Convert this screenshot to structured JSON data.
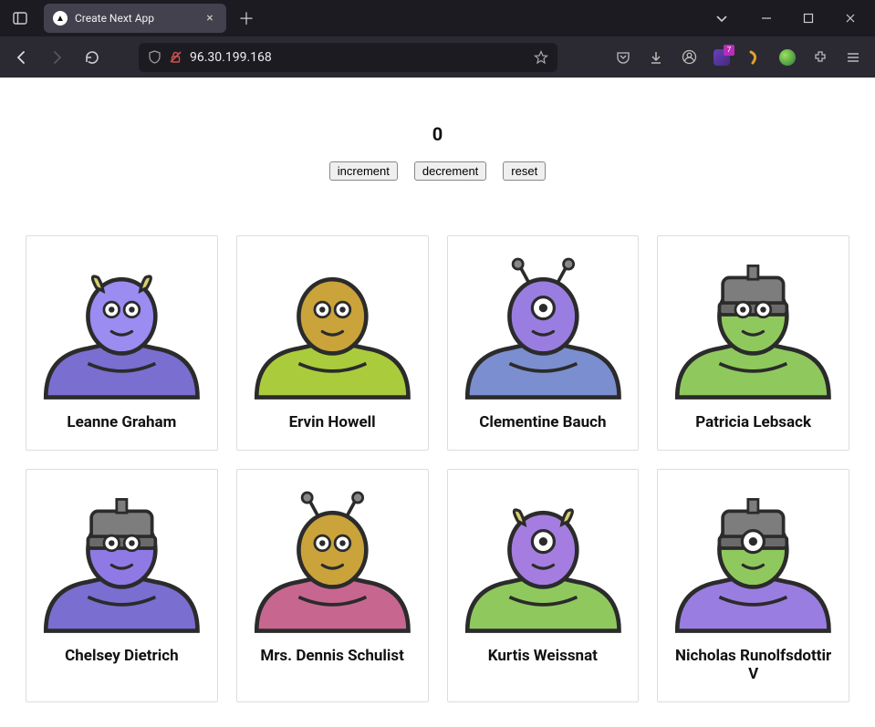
{
  "browser": {
    "tab_title": "Create Next App",
    "url": "96.30.199.168",
    "ext_badge": "7"
  },
  "counter": {
    "value": "0",
    "increment_label": "increment",
    "decrement_label": "decrement",
    "reset_label": "reset"
  },
  "users": [
    {
      "name": "Leanne Graham",
      "skin": "#9a8cf0",
      "body": "#7a6ed0",
      "eyes": 2,
      "horns": true,
      "helmet": false,
      "antenna": false
    },
    {
      "name": "Ervin Howell",
      "skin": "#caa33a",
      "body": "#aacc3c",
      "eyes": 2,
      "horns": false,
      "helmet": false,
      "antenna": false
    },
    {
      "name": "Clementine Bauch",
      "skin": "#9a7de0",
      "body": "#7b8ecf",
      "eyes": 1,
      "horns": false,
      "helmet": false,
      "antenna": true
    },
    {
      "name": "Patricia Lebsack",
      "skin": "#8fc95e",
      "body": "#8fc95e",
      "eyes": 2,
      "horns": false,
      "helmet": true,
      "antenna": false
    },
    {
      "name": "Chelsey Dietrich",
      "skin": "#8f7ae5",
      "body": "#7a6ed0",
      "eyes": 2,
      "horns": false,
      "helmet": true,
      "antenna": false
    },
    {
      "name": "Mrs. Dennis Schulist",
      "skin": "#caa33a",
      "body": "#c76790",
      "eyes": 2,
      "horns": false,
      "helmet": false,
      "antenna": true
    },
    {
      "name": "Kurtis Weissnat",
      "skin": "#a57de0",
      "body": "#8fc95e",
      "eyes": 1,
      "horns": true,
      "helmet": false,
      "antenna": false
    },
    {
      "name": "Nicholas Runolfsdottir V",
      "skin": "#8fc95e",
      "body": "#9a7de0",
      "eyes": 1,
      "horns": false,
      "helmet": true,
      "antenna": false
    }
  ]
}
